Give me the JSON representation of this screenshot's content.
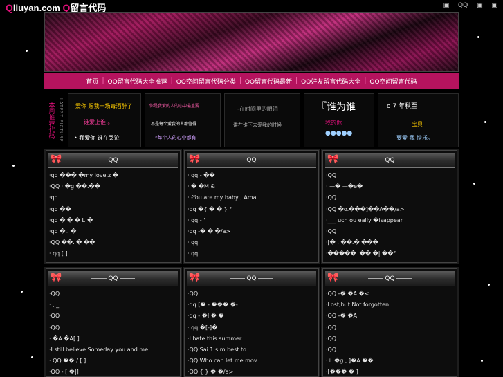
{
  "site": {
    "logo_q": "Q",
    "logo_main": "liuyan.com",
    "logo_q2": "Q",
    "logo_tail": "留言代码"
  },
  "toplinks": [
    "▣",
    "QQ",
    "▣",
    "▣"
  ],
  "nav": [
    "首页",
    "QQ留言代码大全推荐",
    "QQ空间留言代码分类",
    "QQ留言代码最新",
    "QQ好友留言代码大全",
    "QQ空间留言代码"
  ],
  "featured": {
    "label": "本周推荐代码",
    "label2": "LATEST PICTURE",
    "box1": [
      "爱你 赐我一场毒酒醉了",
      "谁爱上谁 。",
      "• 我爱你 谁在哭泣"
    ],
    "box2": [
      "你是我爱的人的心中最重要",
      "不是每个爱我的人都值得",
      "*每个人的心中都有"
    ],
    "box3": [
      "-在时间里的眼泪",
      "谁在谁下去爱我的时候"
    ],
    "box4": [
      "『谁为谁",
      "我的你",
      "●●●●●"
    ],
    "box5": [
      "o 7 年秋至",
      "宝贝",
      "要爱 我 快乐。"
    ]
  },
  "panels": [
    {
      "title": "QQ",
      "rows": [
        "·qq      ���  �my love.z �",
        "·QQ      · �g ��.��",
        "·qq",
        "·qq      ��",
        "·qq         � � � L!�",
        "·qq       �..  �'",
        "·QQ         ��. �  ��",
        "·  qq    [  ]"
      ]
    },
    {
      "title": "QQ",
      "rows": [
        "·  qq      - ��",
        "·          �  �M    &",
        "·        -You are my baby , Ama",
        "·qq       �{ �  � } °",
        "·  qq    -        '",
        "·qq          -�   � �/a>",
        "·  qq",
        "·  qq"
      ]
    },
    {
      "title": "QQ",
      "rows": [
        "·QQ",
        "· —�   —�e�",
        "·QQ",
        "·QQ       �o.���]��A��/a>",
        "·___ uch  ou  eally  �isappear",
        "·QQ",
        "·[�   . ��.�   ���",
        "·�����.  ��.�| ��°"
      ]
    },
    {
      "title": "QQ",
      "rows": [
        "·QQ         :",
        "·   ,   _",
        "·QQ",
        "·QQ         :",
        "·  �A       �A[ ]",
        "·I still believe Someday you and me",
        "·   QQ     �� / [ ]",
        "·QQ     - [ �|]"
      ]
    },
    {
      "title": "QQ",
      "rows": [
        "·QQ",
        "·qq         [� - ���  �-",
        "·qq       -  �I  �  �",
        "·  qq        �[-]�",
        "·I hate this summer",
        "·QQ          Sai 1 s m  best to",
        "·QQ          Who can let me mov",
        "·QQ          { } �    �/a>"
      ]
    },
    {
      "title": "QQ",
      "rows": [
        "·QQ         -�  �A �<",
        "·Lost,but Not forgotten",
        "·QQ         -�       �A",
        "·QQ",
        "·QQ",
        "·QQ",
        "·⊥  �g ,   ]�A ��..",
        "·[���  �  ]"
      ]
    }
  ],
  "colors": {
    "accent": "#e0107a",
    "nav_bg": "#b5135e"
  }
}
